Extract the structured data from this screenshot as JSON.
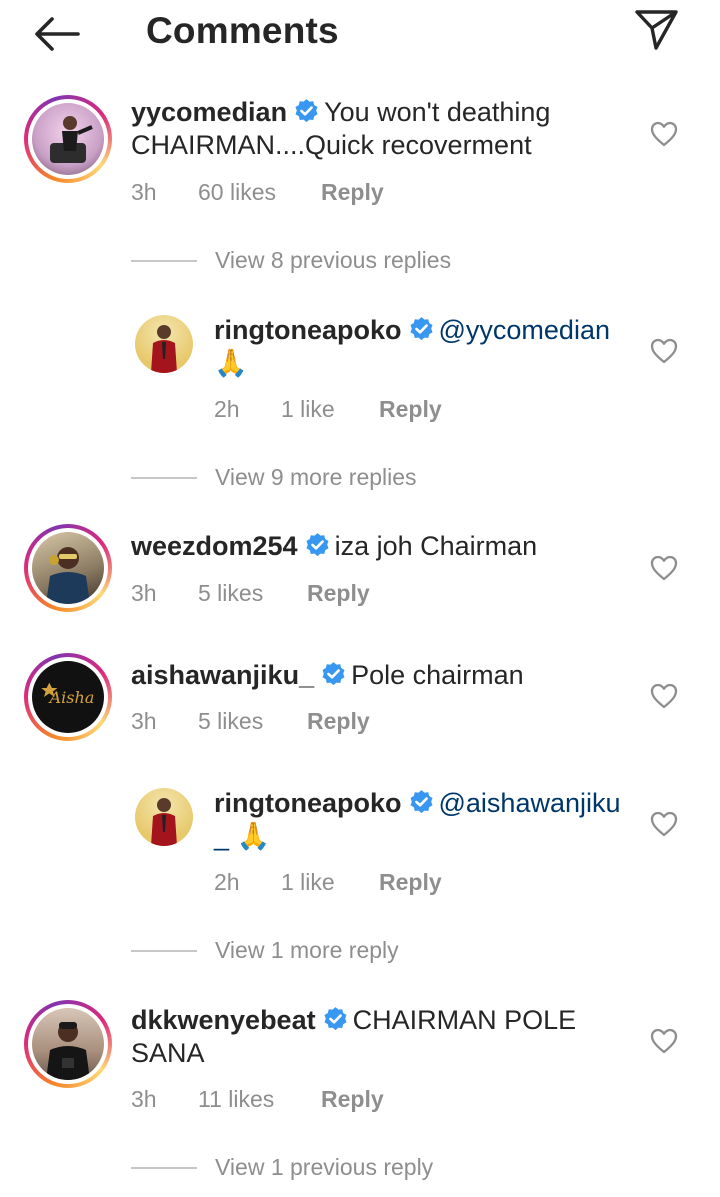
{
  "header": {
    "title": "Comments",
    "back_icon": "arrow-left-icon",
    "send_icon": "paper-plane-icon"
  },
  "comments": [
    {
      "username": "yycomedian",
      "verified": true,
      "text_line1": "You won't deathing",
      "text_line2": "CHAIRMAN....Quick recoverment",
      "time": "3h",
      "likes": "60 likes",
      "reply": "Reply"
    },
    {
      "username": "ringtoneapoko",
      "verified": true,
      "mention": "@yycomedian",
      "text_line2": "🙏",
      "time": "2h",
      "likes": "1 like",
      "reply": "Reply"
    },
    {
      "username": "weezdom254",
      "verified": true,
      "text_line1": "iza joh Chairman",
      "time": "3h",
      "likes": "5 likes",
      "reply": "Reply"
    },
    {
      "username": "aishawanjiku_",
      "verified": true,
      "text_line1": "Pole chairman",
      "time": "3h",
      "likes": "5 likes",
      "reply": "Reply",
      "avatar_text": "Aisha"
    },
    {
      "username": "ringtoneapoko",
      "verified": true,
      "mention": "@aishawanjiku",
      "text_line2": "_ 🙏",
      "time": "2h",
      "likes": "1 like",
      "reply": "Reply"
    },
    {
      "username": "dkkwenyebeat",
      "verified": true,
      "text_line1": "CHAIRMAN POLE",
      "text_line2": "SANA",
      "time": "3h",
      "likes": "11 likes",
      "reply": "Reply"
    }
  ],
  "view_links": [
    "View 8 previous replies",
    "View 9 more replies",
    "View 1 more reply",
    "View 1 previous reply"
  ],
  "colors": {
    "text": "#262626",
    "muted": "#8e8e8e",
    "verified_blue": "#3897f0",
    "mention": "#00376b"
  }
}
